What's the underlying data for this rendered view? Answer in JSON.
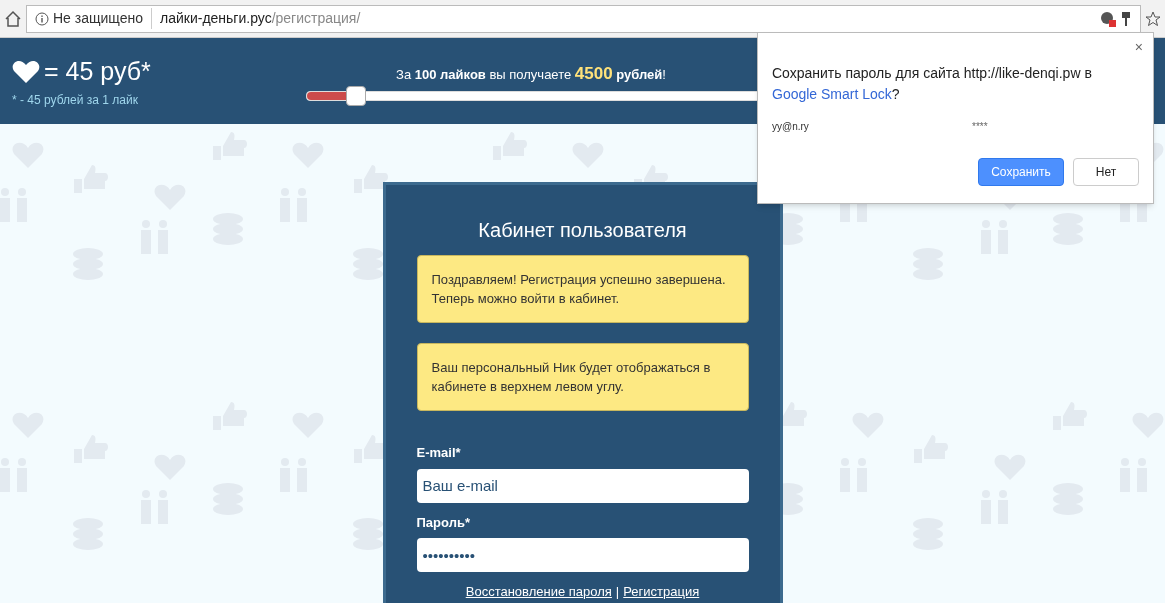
{
  "browser": {
    "security": "Не защищено",
    "url_host": "лайки-деньги.рус",
    "url_path": "/регистрация/"
  },
  "header": {
    "rate": "= 45 руб*",
    "note": "* - 45 рублей за 1 лайк",
    "caption_before": "За **100 лайков** вы получаете",
    "amount": "4500",
    "caption_after": "**рублей**!",
    "slider": {
      "level": 0.07
    }
  },
  "card": {
    "title": "Кабинет пользователя",
    "alerts": [
      "Поздравляем! Регистрация успешно завершена. Теперь можно войти в кабинет.",
      "Ваш персональный Ник будет отображаться в кабинете в верхнем левом углу."
    ],
    "fields": [
      {
        "label": "E-mail*",
        "placeholder": "Ваш e-mail"
      },
      {
        "label": "Пароль*",
        "value": "••••••••••"
      }
    ],
    "links": [
      {
        "text": "Восстановление пароля"
      },
      {
        "text": "|",
        "kind": "separator"
      },
      {
        "text": "Регистрация"
      }
    ]
  },
  "save_password_popup": {
    "close": "×",
    "message": "Сохранить пароль для сайта http://like-denqi.pw в",
    "link": "Google Smart Lock",
    "after_link": "?",
    "username": "yy@n.ry",
    "password": "****",
    "buttons": [
      {
        "label": "Сохранить",
        "kind": "primary"
      },
      {
        "label": "Нет",
        "kind": "secondary"
      }
    ]
  }
}
